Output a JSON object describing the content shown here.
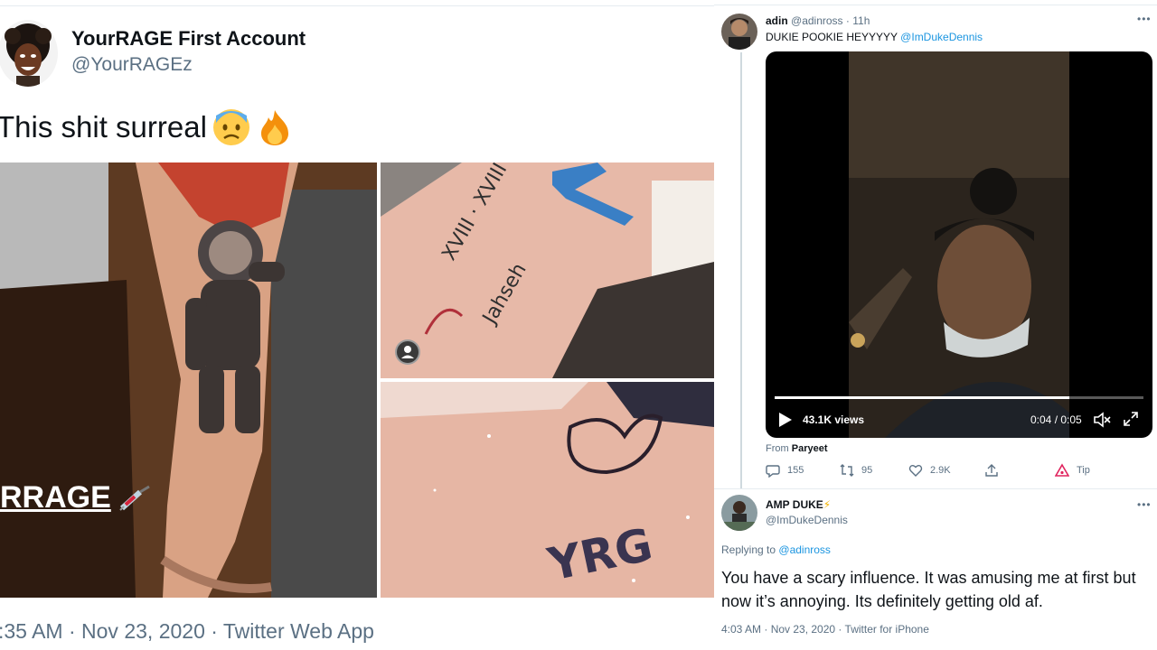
{
  "left_tweet": {
    "display_name": "YourRAGE First Account",
    "handle": "@YourRAGEz",
    "text": "This shit surreal",
    "emojis": [
      "anxious-face-emoji",
      "fire-emoji"
    ],
    "media_overlay_text": "RRAGE",
    "meta": ":35 AM · Nov 23, 2020 · Twitter Web App",
    "tattoo_texts": [
      "XVIII",
      "XVIII · XVIII",
      "Jahseh",
      "YRG"
    ]
  },
  "right_thread": {
    "first_reply": {
      "name": "adin",
      "handle": "@adinross",
      "time": "· 11h",
      "text": "DUKIE POOKIE HEYYYYY",
      "mention": "@ImDukeDennis",
      "video": {
        "views": "43.1K views",
        "time": "0:04 / 0:05",
        "progress": 0.8
      },
      "from_label": "From",
      "from_source": "Paryeet",
      "actions": {
        "reply_count": "155",
        "retweet_count": "95",
        "like_count": "2.9K",
        "tip_label": "Tip"
      }
    },
    "second_reply": {
      "name": "AMP DUKE",
      "name_emoji": "⚡",
      "handle": "@ImDukeDennis",
      "replying_prefix": "Replying to",
      "replying_to": "@adinross",
      "text": "You have a scary influence. It was amusing me at first but now it’s annoying. Its definitely getting old af.",
      "meta": "4:03 AM · Nov 23, 2020 · Twitter for iPhone"
    },
    "more_icon": "•••"
  },
  "colors": {
    "secondary_text": "#5b7083",
    "link": "#1b95e0",
    "divider": "#e6ecf0",
    "tip_red": "#e0245e"
  }
}
